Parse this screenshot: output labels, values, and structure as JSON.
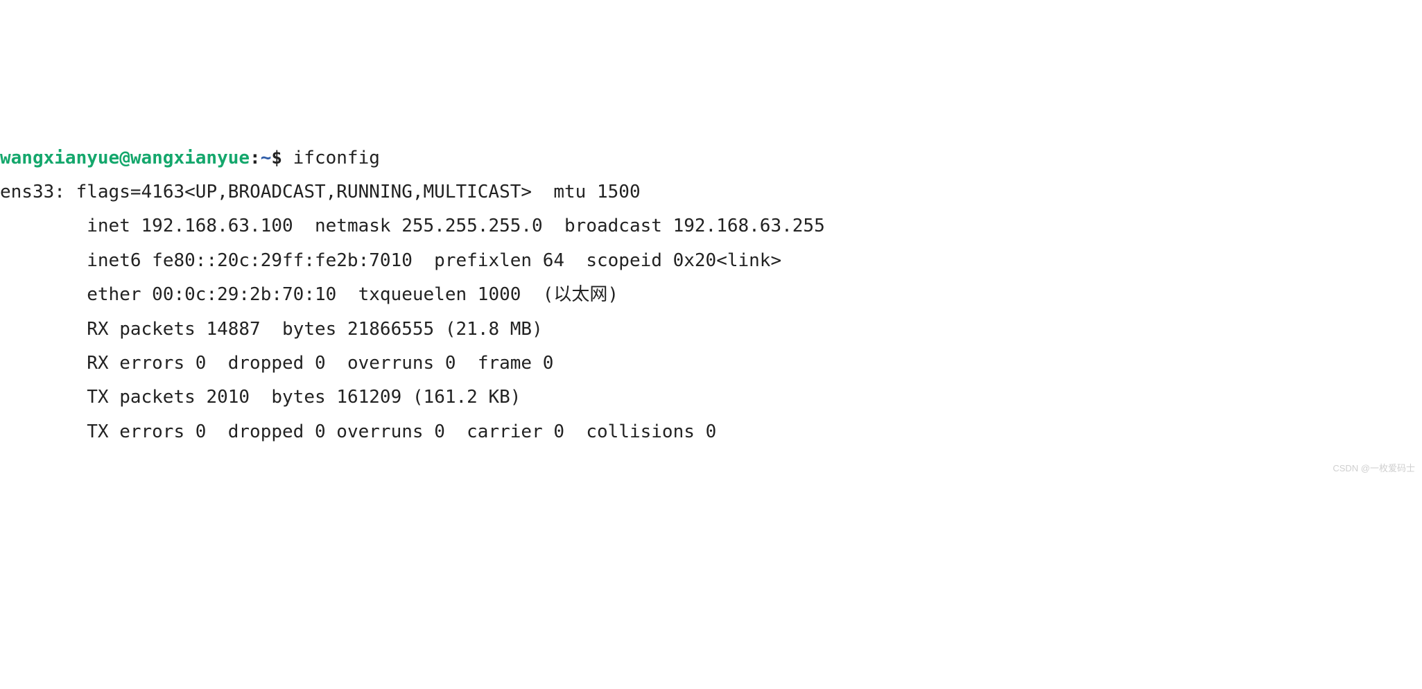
{
  "prompt": {
    "user": "wangxianyue",
    "host": "wangxianyue",
    "path": "~",
    "symbol": "$"
  },
  "command": "ifconfig",
  "iface": {
    "name": "ens33",
    "flags_num": "4163",
    "flags_list": "UP,BROADCAST,RUNNING,MULTICAST",
    "mtu": "1500",
    "inet": {
      "addr": "192.168.63.100",
      "netmask": "255.255.255.0",
      "broadcast": "192.168.63.255"
    },
    "inet6": {
      "addr": "fe80::20c:29ff:fe2b:7010",
      "prefixlen": "64",
      "scopeid": "0x20<link>"
    },
    "ether": {
      "mac": "00:0c:29:2b:70:10",
      "txqueuelen": "1000",
      "type": "(以太网)"
    },
    "rx": {
      "packets": "14887",
      "bytes": "21866555",
      "bytes_human": "(21.8 MB)"
    },
    "rx_err": {
      "errors": "0",
      "dropped": "0",
      "overruns": "0",
      "frame": "0"
    },
    "tx": {
      "packets": "2010",
      "bytes": "161209",
      "bytes_human": "(161.2 KB)"
    },
    "tx_err": {
      "errors": "0",
      "dropped": "0",
      "overruns": "0",
      "carrier": "0",
      "collisions": "0"
    }
  },
  "labels": {
    "flags": "flags=",
    "mtu": "mtu",
    "inet": "inet",
    "netmask": "netmask",
    "broadcast": "broadcast",
    "inet6": "inet6",
    "prefixlen": "prefixlen",
    "scopeid": "scopeid",
    "ether": "ether",
    "txqueuelen": "txqueuelen",
    "rx_packets": "RX packets",
    "bytes": "bytes",
    "rx_errors": "RX errors",
    "dropped": "dropped",
    "overruns": "overruns",
    "frame": "frame",
    "tx_packets": "TX packets",
    "tx_errors": "TX errors",
    "carrier": "carrier",
    "collisions": "collisions"
  },
  "watermark": "CSDN @一枚爱码士"
}
